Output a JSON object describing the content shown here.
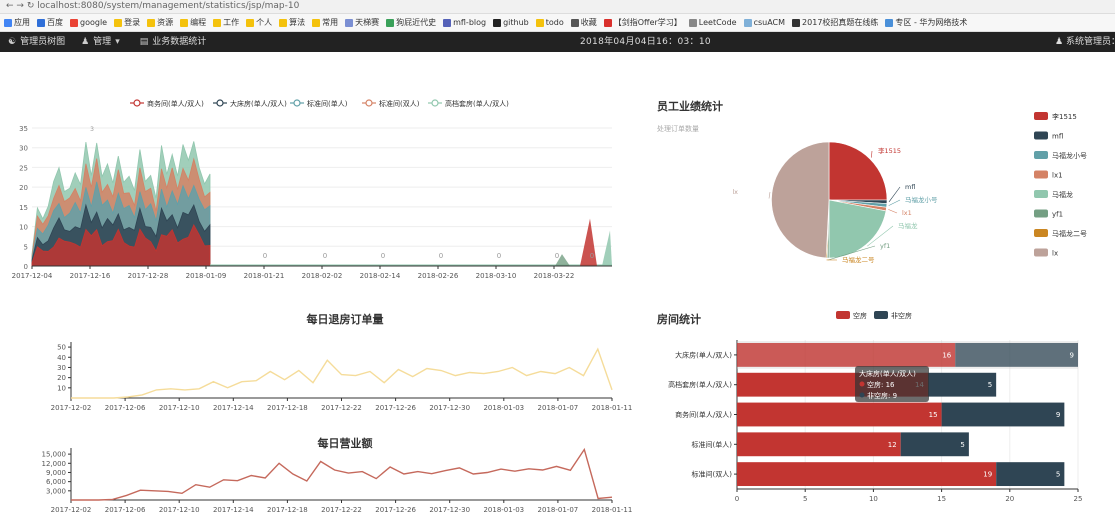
{
  "browser": {
    "url": "localhost:8080/system/management/statistics/jsp/map-10",
    "bookmarks": [
      {
        "label": "应用",
        "color": "#4285f4"
      },
      {
        "label": "百度",
        "color": "#2f6fd8"
      },
      {
        "label": "google",
        "color": "#ea4335"
      },
      {
        "label": "登录",
        "color": "#f4c20d"
      },
      {
        "label": "资源",
        "color": "#f4c20d"
      },
      {
        "label": "编程",
        "color": "#f4c20d"
      },
      {
        "label": "工作",
        "color": "#f4c20d"
      },
      {
        "label": "个人",
        "color": "#f4c20d"
      },
      {
        "label": "算法",
        "color": "#f4c20d"
      },
      {
        "label": "常用",
        "color": "#f4c20d"
      },
      {
        "label": "天梯赛",
        "color": "#7b8fd3"
      },
      {
        "label": "狗屁近代史",
        "color": "#3aa15a"
      },
      {
        "label": "mfl-blog",
        "color": "#5562b8"
      },
      {
        "label": "github",
        "color": "#222222"
      },
      {
        "label": "todo",
        "color": "#f4c20d"
      },
      {
        "label": "收藏",
        "color": "#555555"
      },
      {
        "label": "【剑指Offer学习】",
        "color": "#d9302c"
      },
      {
        "label": "LeetCode",
        "color": "#888888"
      },
      {
        "label": "csuACM",
        "color": "#7fb0d8"
      },
      {
        "label": "2017校招真题在线练",
        "color": "#333333"
      },
      {
        "label": "专区 - 华为网络技术",
        "color": "#4a90d9"
      }
    ]
  },
  "navbar": {
    "tree_label": "管理员树图",
    "manage_label": "管理",
    "stats_label": "业务数据统计",
    "datetime": "2018年04月04日16：03：10",
    "user_label": "系统管理员："
  },
  "colors": {
    "red": "#c23531",
    "navy": "#2f4554",
    "teal": "#61a0a8",
    "orange": "#d48265",
    "mint": "#91c7ae",
    "green": "#749f83",
    "gold": "#ca8622",
    "tan": "#bda29a",
    "yellow": "#f5dc9a",
    "brown": "#c5695c"
  },
  "chart_data": [
    {
      "id": "room-type-area",
      "type": "area",
      "title": "",
      "legend": [
        "商务间(单人/双人)",
        "大床房(单人/双人)",
        "标准间(单人)",
        "标准间(双人)",
        "高档套房(单人/双人)"
      ],
      "x_ticks": [
        "2017-12-04",
        "2017-12-16",
        "2017-12-28",
        "2018-01-09",
        "2018-01-21",
        "2018-02-02",
        "2018-02-14",
        "2018-02-26",
        "2018-03-10",
        "2018-03-22"
      ],
      "ylim": [
        0,
        35
      ],
      "y_ticks": [
        0,
        5,
        10,
        15,
        20,
        25,
        30,
        35
      ],
      "zero_labels": [
        "0",
        "0",
        "0",
        "0",
        "0",
        "0",
        "0"
      ],
      "peak_label": "3",
      "stack_totals": [
        3,
        14,
        12,
        16,
        22,
        24,
        18,
        20,
        25,
        21,
        30,
        22,
        32,
        24,
        26,
        20,
        27,
        22,
        24,
        19,
        28,
        21,
        24,
        18,
        30,
        22,
        28,
        24,
        32,
        26,
        30,
        25,
        22,
        24
      ]
    },
    {
      "id": "staff-pie",
      "type": "pie",
      "title": "员工业绩统计",
      "subtitle": "处理订单数量",
      "slices": [
        {
          "name": "李1515",
          "value": 25
        },
        {
          "name": "mfl",
          "value": 1
        },
        {
          "name": "马福龙小号",
          "value": 1
        },
        {
          "name": "lx1",
          "value": 1
        },
        {
          "name": "马福龙",
          "value": 22
        },
        {
          "name": "yf1",
          "value": 0.5
        },
        {
          "name": "马福龙二号",
          "value": 0.3
        },
        {
          "name": "lx",
          "value": 49.2
        }
      ]
    },
    {
      "id": "checkout-line",
      "type": "line",
      "title": "每日退房订单量",
      "x_ticks": [
        "2017-12-02",
        "2017-12-06",
        "2017-12-10",
        "2017-12-14",
        "2017-12-18",
        "2017-12-22",
        "2017-12-26",
        "2017-12-30",
        "2018-01-03",
        "2018-01-07",
        "2018-01-11"
      ],
      "ylim": [
        0,
        55
      ],
      "y_ticks": [
        10,
        20,
        30,
        40,
        50
      ],
      "values": [
        0,
        0,
        0,
        0,
        1,
        3,
        8,
        9,
        8,
        9,
        16,
        10,
        16,
        17,
        26,
        18,
        27,
        15,
        37,
        23,
        22,
        26,
        15,
        28,
        21,
        29,
        27,
        22,
        25,
        24,
        26,
        30,
        22,
        26,
        24,
        30,
        22,
        48,
        8
      ]
    },
    {
      "id": "revenue-line",
      "type": "line",
      "title": "每日营业额",
      "x_ticks": [
        "2017-12-02",
        "2017-12-06",
        "2017-12-10",
        "2017-12-14",
        "2017-12-18",
        "2017-12-22",
        "2017-12-26",
        "2017-12-30",
        "2018-01-03",
        "2018-01-07",
        "2018-01-11"
      ],
      "ylim": [
        0,
        17000
      ],
      "y_ticks": [
        3000,
        6000,
        9000,
        12000,
        15000
      ],
      "y_tick_labels": [
        "3,000",
        "6,000",
        "9,000",
        "12,000",
        "15,000"
      ],
      "values": [
        0,
        0,
        0,
        200,
        1500,
        3200,
        3000,
        2800,
        2200,
        5000,
        4200,
        6600,
        6300,
        8000,
        7200,
        12000,
        8500,
        6200,
        12600,
        9800,
        8800,
        9300,
        7000,
        10800,
        8500,
        9300,
        8600,
        9600,
        10500,
        8500,
        9000,
        10100,
        9400,
        10200,
        9800,
        11000,
        9700,
        16500,
        500,
        900
      ]
    },
    {
      "id": "room-stats-bar",
      "type": "bar",
      "title": "房间统计",
      "legend": [
        "空房",
        "非空房"
      ],
      "categories": [
        "大床房(单人/双人)",
        "高档套房(单人/双人)",
        "商务间(单人/双人)",
        "标准间(单人)",
        "标准间(双人)"
      ],
      "series": [
        {
          "name": "空房",
          "values": [
            16,
            14,
            15,
            12,
            19
          ]
        },
        {
          "name": "非空房",
          "values": [
            9,
            5,
            9,
            5,
            5
          ]
        }
      ],
      "xlim": [
        0,
        25
      ],
      "x_ticks": [
        0,
        5,
        10,
        15,
        20,
        25
      ],
      "tooltip": {
        "title": "大床房(单人/双人)",
        "line1": "空房: 16",
        "line2": "非空房: 9"
      }
    }
  ]
}
